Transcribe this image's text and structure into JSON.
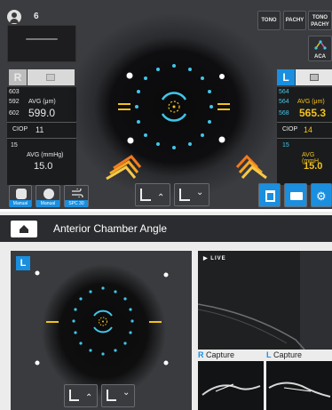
{
  "top": {
    "patient_count": "6",
    "tono_label": "TONO",
    "pachy_label": "PACHY",
    "tono_pachy_label": "TONO\nPACHY",
    "aca_label": "ACA",
    "left_letter": "R",
    "right_letter": "L",
    "left": {
      "v1": "603",
      "v2": "592",
      "v3": "602",
      "avg_label": "AVG (μm)",
      "avg_value": "599.0",
      "ciop_label": "CIOP",
      "ciop_value": "11",
      "iop": "15",
      "iop_avg_label": "AVG (mmHg)",
      "iop_avg_value": "15.0"
    },
    "right": {
      "v1": "564",
      "v2": "564",
      "v3": "568",
      "avg_label": "AVG (μm)",
      "avg_value": "565.3",
      "ciop_label": "CIOP",
      "ciop_value": "14",
      "iop": "15",
      "iop_avg_label": "AVG (mmH",
      "iop_avg_value": "15.0"
    },
    "manual1": "Manual",
    "manual2": "Manual",
    "spc_label": "SPC",
    "spc_value": "30"
  },
  "bottom": {
    "title": "Anterior Chamber Angle",
    "eye_badge": "L",
    "live_label": "LIVE",
    "r_capture_letter": "R",
    "r_capture_label": "Capture",
    "l_capture_letter": "L",
    "l_capture_label": "Capture"
  },
  "colors": {
    "accent_blue": "#1a8fe0",
    "cyan": "#41c6e9",
    "gold": "#f3c21b",
    "orange": "#f07a1e",
    "header_bg": "#2b2c2f"
  }
}
